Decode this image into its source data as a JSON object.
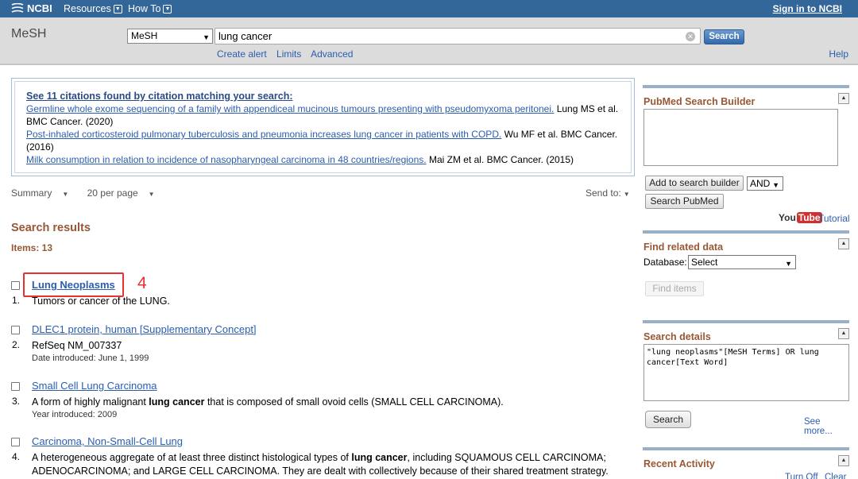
{
  "topbar": {
    "logo": "NCBI",
    "resources": "Resources",
    "howto": "How To",
    "signin": "Sign in to NCBI"
  },
  "search": {
    "db_title": "MeSH",
    "db_select": "MeSH",
    "term": "lung cancer",
    "button": "Search",
    "links": [
      "Create alert",
      "Limits",
      "Advanced"
    ],
    "help": "Help"
  },
  "citations": {
    "heading": "See 11 citations found by citation matching your search:",
    "items": [
      {
        "link": "Germline whole exome sequencing of a family with appendiceal mucinous tumours presenting with pseudomyxoma peritonei.",
        "rest": " Lung MS et al. BMC Cancer. (2020)"
      },
      {
        "link": "Post-inhaled corticosteroid pulmonary tuberculosis and pneumonia increases lung cancer in patients with COPD.",
        "rest": " Wu MF et al. BMC Cancer. (2016)"
      },
      {
        "link": "Milk consumption in relation to incidence of nasopharyngeal carcinoma in 48 countries/regions.",
        "rest": " Mai ZM et al. BMC Cancer. (2015)"
      }
    ]
  },
  "display": {
    "summary": "Summary",
    "per_page": "20 per page",
    "send_to": "Send to:"
  },
  "results": {
    "title": "Search results",
    "items_label": "Items: 13",
    "annotation": "4",
    "list": [
      {
        "num": "1.",
        "title": "Lung Neoplasms",
        "desc_pre": "Tumors or cancer of the LUNG.",
        "desc_bold": "",
        "desc_post": "",
        "meta": ""
      },
      {
        "num": "2.",
        "title": "DLEC1 protein, human [Supplementary Concept]",
        "desc_pre": "RefSeq NM_007337",
        "desc_bold": "",
        "desc_post": "",
        "meta": "Date introduced: June 1, 1999"
      },
      {
        "num": "3.",
        "title": "Small Cell Lung Carcinoma",
        "desc_pre": "A form of highly malignant ",
        "desc_bold": "lung cancer",
        "desc_post": " that is composed of small ovoid cells (SMALL CELL CARCINOMA).",
        "meta": "Year introduced: 2009"
      },
      {
        "num": "4.",
        "title": "Carcinoma, Non-Small-Cell Lung",
        "desc_pre": "A heterogeneous aggregate of at least three distinct histological types of ",
        "desc_bold": "lung cancer",
        "desc_post": ", including SQUAMOUS CELL CARCINOMA; ADENOCARCINOMA; and LARGE CELL CARCINOMA. They are dealt with collectively because of their shared treatment strategy.",
        "meta": ""
      }
    ]
  },
  "sidebar": {
    "builder": {
      "title": "PubMed Search Builder",
      "add_button": "Add to search builder",
      "operator": "AND",
      "search_button": "Search PubMed",
      "youtube": "You",
      "youtube_tube": "Tube",
      "tutorial": "Tutorial"
    },
    "related": {
      "title": "Find related data",
      "database_label": "Database:",
      "database_select": "Select",
      "find_button": "Find items"
    },
    "details": {
      "title": "Search details",
      "query": "\"lung neoplasms\"[MeSH Terms] OR lung cancer[Text Word]",
      "search_button": "Search",
      "see_more": "See more..."
    },
    "recent": {
      "title": "Recent Activity",
      "turn_off": "Turn Off",
      "clear": "Clear"
    }
  }
}
